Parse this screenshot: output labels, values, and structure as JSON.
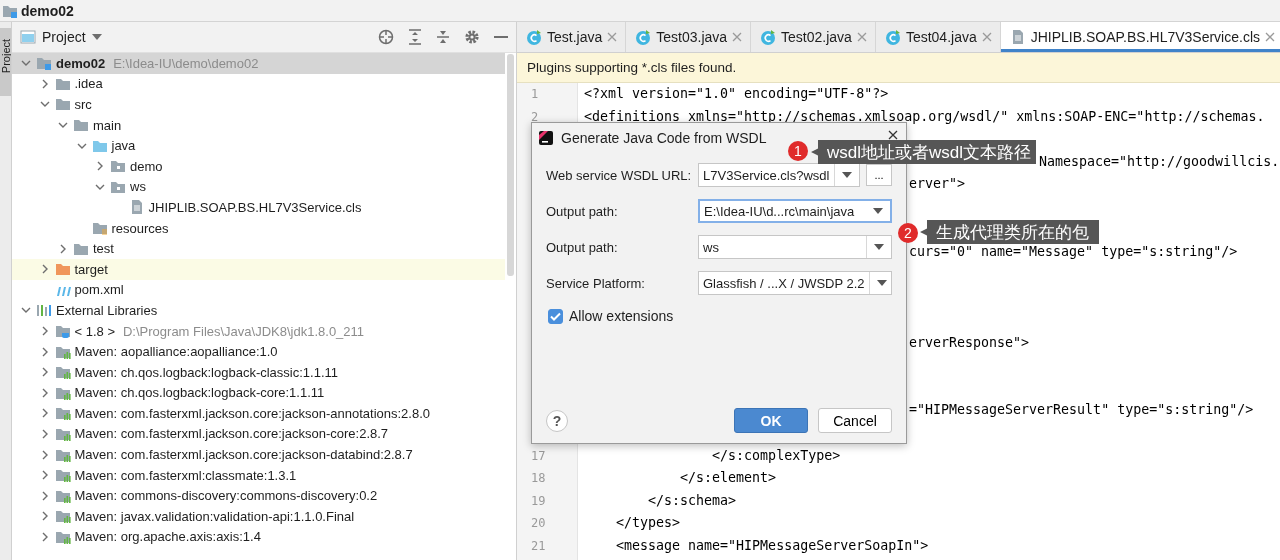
{
  "window": {
    "title": "demo02"
  },
  "side_strip": {
    "label": "Project"
  },
  "project_panel": {
    "title": "Project",
    "tree": [
      {
        "label": "demo02",
        "detail": "E:\\Idea-IU\\demo\\demo02",
        "kind": "module",
        "expanded": true,
        "selected": true,
        "highlighted": false,
        "children": [
          {
            "label": ".idea",
            "kind": "folder",
            "expanded": false,
            "selected": false,
            "highlighted": false
          },
          {
            "label": "src",
            "kind": "folder",
            "expanded": true,
            "selected": false,
            "highlighted": false,
            "children": [
              {
                "label": "main",
                "kind": "folder",
                "expanded": true,
                "selected": false,
                "highlighted": false,
                "children": [
                  {
                    "label": "java",
                    "kind": "source",
                    "expanded": true,
                    "selected": false,
                    "highlighted": false,
                    "children": [
                      {
                        "label": "demo",
                        "kind": "package",
                        "expanded": false,
                        "selected": false,
                        "highlighted": false
                      },
                      {
                        "label": "ws",
                        "kind": "package",
                        "expanded": true,
                        "selected": false,
                        "highlighted": false,
                        "children": [
                          {
                            "label": "JHIPLIB.SOAP.BS.HL7V3Service.cls",
                            "kind": "file",
                            "selected": false,
                            "highlighted": false
                          }
                        ]
                      }
                    ]
                  },
                  {
                    "label": "resources",
                    "kind": "resources",
                    "selected": false,
                    "highlighted": false
                  }
                ]
              },
              {
                "label": "test",
                "kind": "folder",
                "expanded": false,
                "selected": false,
                "highlighted": false
              }
            ]
          },
          {
            "label": "target",
            "kind": "excluded",
            "expanded": false,
            "selected": false,
            "highlighted": true
          },
          {
            "label": "pom.xml",
            "kind": "pom",
            "selected": false,
            "highlighted": false
          }
        ]
      },
      {
        "label": "External Libraries",
        "kind": "libraries",
        "expanded": true,
        "selected": false,
        "highlighted": false,
        "children": [
          {
            "label": "< 1.8 >",
            "detail": "D:\\Program Files\\Java\\JDK8\\jdk1.8.0_211",
            "kind": "jdk",
            "expanded": false,
            "selected": false,
            "highlighted": false
          },
          {
            "label": "Maven: aopalliance:aopalliance:1.0",
            "kind": "library",
            "expanded": false,
            "selected": false,
            "highlighted": false
          },
          {
            "label": "Maven: ch.qos.logback:logback-classic:1.1.11",
            "kind": "library",
            "expanded": false,
            "selected": false,
            "highlighted": false
          },
          {
            "label": "Maven: ch.qos.logback:logback-core:1.1.11",
            "kind": "library",
            "expanded": false,
            "selected": false,
            "highlighted": false
          },
          {
            "label": "Maven: com.fasterxml.jackson.core:jackson-annotations:2.8.0",
            "kind": "library",
            "expanded": false,
            "selected": false,
            "highlighted": false
          },
          {
            "label": "Maven: com.fasterxml.jackson.core:jackson-core:2.8.7",
            "kind": "library",
            "expanded": false,
            "selected": false,
            "highlighted": false
          },
          {
            "label": "Maven: com.fasterxml.jackson.core:jackson-databind:2.8.7",
            "kind": "library",
            "expanded": false,
            "selected": false,
            "highlighted": false
          },
          {
            "label": "Maven: com.fasterxml:classmate:1.3.1",
            "kind": "library",
            "expanded": false,
            "selected": false,
            "highlighted": false
          },
          {
            "label": "Maven: commons-discovery:commons-discovery:0.2",
            "kind": "library",
            "expanded": false,
            "selected": false,
            "highlighted": false
          },
          {
            "label": "Maven: javax.validation:validation-api:1.1.0.Final",
            "kind": "library",
            "expanded": false,
            "selected": false,
            "highlighted": false
          },
          {
            "label": "Maven: org.apache.axis:axis:1.4",
            "kind": "library",
            "expanded": false,
            "selected": false,
            "highlighted": false
          }
        ]
      }
    ]
  },
  "editor": {
    "tabs": [
      {
        "label": "Test.java",
        "kind": "class",
        "selected": false
      },
      {
        "label": "Test03.java",
        "kind": "class",
        "selected": false
      },
      {
        "label": "Test02.java",
        "kind": "class",
        "selected": false
      },
      {
        "label": "Test04.java",
        "kind": "class",
        "selected": false
      },
      {
        "label": "JHIPLIB.SOAP.BS.HL7V3Service.cls",
        "kind": "file",
        "selected": true
      }
    ],
    "banner": "Plugins supporting *.cls files found.",
    "lines": [
      {
        "kind": "full",
        "number": "1",
        "text": "<?xml version=\"1.0\" encoding=\"UTF-8\"?>"
      },
      {
        "kind": "full",
        "number": "2",
        "text": "<definitions xmlns=\"http://schemas.xmlsoap.org/wsdl/\" xmlns:SOAP-ENC=\"http://schemas."
      },
      {
        "kind": "covered"
      },
      {
        "kind": "after-callout",
        "text": "Namespace=\"http://goodwillcis."
      },
      {
        "kind": "after-dialog",
        "text": "erver\">"
      },
      {
        "kind": "covered"
      },
      {
        "kind": "covered"
      },
      {
        "kind": "after-dialog",
        "text": "curs=\"0\" name=\"Message\" type=\"s:string\"/>"
      },
      {
        "kind": "covered"
      },
      {
        "kind": "covered"
      },
      {
        "kind": "covered"
      },
      {
        "kind": "after-dialog",
        "text": "erverResponse\">"
      },
      {
        "kind": "covered"
      },
      {
        "kind": "covered"
      },
      {
        "kind": "after-dialog",
        "text": "=\"HIPMessageServerResult\" type=\"s:string\"/>"
      },
      {
        "kind": "covered"
      },
      {
        "kind": "full",
        "number": "17",
        "text": "                </s:complexType>"
      },
      {
        "kind": "full",
        "number": "18",
        "text": "            </s:element>"
      },
      {
        "kind": "full",
        "number": "19",
        "text": "        </s:schema>"
      },
      {
        "kind": "full",
        "number": "20",
        "text": "    </types>"
      },
      {
        "kind": "full",
        "number": "21",
        "text": "    <message name=\"HIPMessageServerSoapIn\">"
      }
    ]
  },
  "dialog": {
    "title": "Generate Java Code from WSDL",
    "fields": [
      {
        "label": "Web service WSDL URL:",
        "value": "L7V3Service.cls?wsdl",
        "focused": false,
        "browse": "..."
      },
      {
        "label": "Output path:",
        "value": "E:\\Idea-IU\\d...rc\\main\\java",
        "focused": true
      },
      {
        "label": "Output path:",
        "value": "ws",
        "focused": false
      },
      {
        "label": "Service Platform:",
        "value": "Glassfish / ...X / JWSDP 2.2",
        "focused": false
      }
    ],
    "checkbox": {
      "label": "Allow extensions",
      "checked": true
    },
    "help": "?",
    "buttons": [
      {
        "label": "OK",
        "default": true
      },
      {
        "label": "Cancel",
        "default": false
      }
    ]
  },
  "annotations": [
    {
      "number": "1",
      "text": "wsdl地址或者wsdl文本路径"
    },
    {
      "number": "2",
      "text": "生成代理类所在的包"
    }
  ]
}
